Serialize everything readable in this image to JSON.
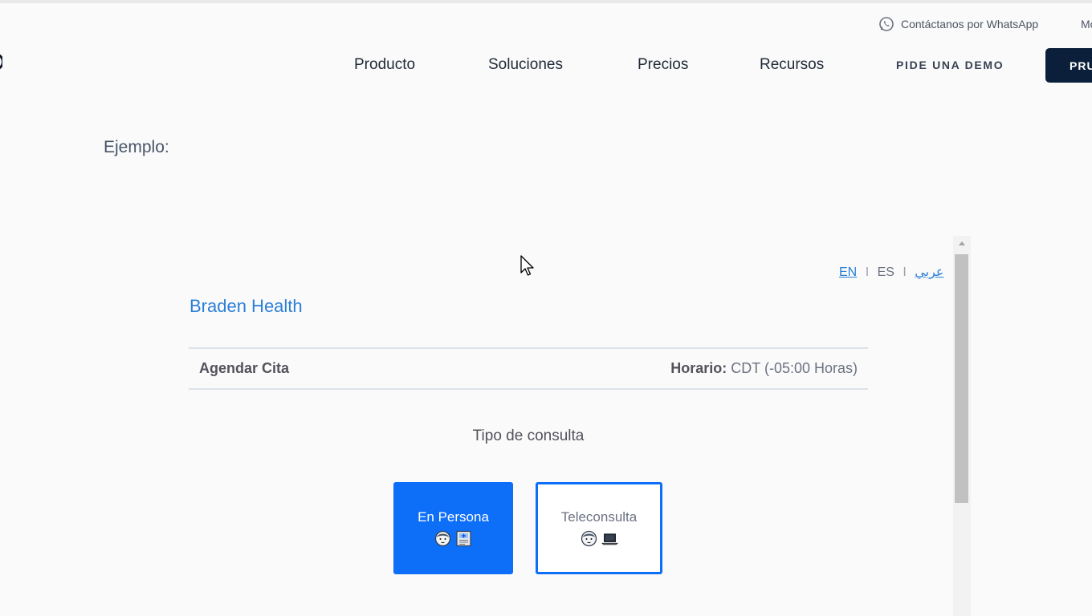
{
  "header": {
    "whatsapp_label": "Contáctanos por WhatsApp",
    "truncated_link": "Mo",
    "nav": [
      "Producto",
      "Soluciones",
      "Precios",
      "Recursos"
    ],
    "demo_label": "PIDE UNA DEMO",
    "trial_label": "PRUEBA"
  },
  "example_label": "Ejemplo:",
  "widget": {
    "languages": {
      "en": "EN",
      "es": "ES",
      "ar": "عربي",
      "separator": "I"
    },
    "clinic_name": "Braden Health",
    "appointment_title": "Agendar Cita",
    "schedule_label": "Horario:",
    "timezone_value": "CDT (-05:00 Horas)",
    "consult_type_title": "Tipo de consulta",
    "options": [
      {
        "label": "En Persona",
        "icons": [
          "doctor-icon",
          "hospital-icon"
        ],
        "selected": true
      },
      {
        "label": "Teleconsulta",
        "icons": [
          "doctor-icon",
          "laptop-icon"
        ],
        "selected": false
      }
    ]
  },
  "colors": {
    "primary": "#0d6ef7",
    "link": "#2b7fd8",
    "navy": "#0b1f3a"
  }
}
